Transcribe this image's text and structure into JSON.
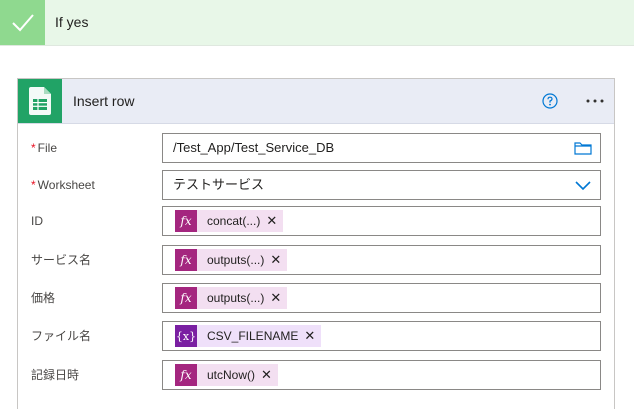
{
  "branch": {
    "title": "If yes"
  },
  "action": {
    "title": "Insert row",
    "fields": [
      {
        "label": "File",
        "required": true,
        "value": "/Test_App/Test_Service_DB",
        "type": "text"
      },
      {
        "label": "Worksheet",
        "required": true,
        "value": "テストサービス",
        "type": "dropdown"
      },
      {
        "label": "ID",
        "required": false,
        "type": "token",
        "token": {
          "kind": "expression",
          "icon": "fx",
          "text": "concat(...)"
        }
      },
      {
        "label": "サービス名",
        "required": false,
        "type": "token",
        "token": {
          "kind": "expression",
          "icon": "fx",
          "text": "outputs(...)"
        }
      },
      {
        "label": "価格",
        "required": false,
        "type": "token",
        "token": {
          "kind": "expression",
          "icon": "fx",
          "text": "outputs(...)"
        }
      },
      {
        "label": "ファイル名",
        "required": false,
        "type": "token",
        "token": {
          "kind": "variable",
          "icon": "{x}",
          "text": "CSV_FILENAME"
        }
      },
      {
        "label": "記録日時",
        "required": false,
        "type": "token",
        "token": {
          "kind": "expression",
          "icon": "fx",
          "text": "utcNow()"
        }
      }
    ]
  },
  "colors": {
    "branch_bg": "#e8f7e8",
    "check_bg": "#8fd98f",
    "card_header_bg": "#e9ecf5",
    "sheets_green": "#21a366",
    "expression_token": "#a4267f",
    "variable_token": "#7a1fa2",
    "accent": "#0078d4",
    "required": "#e81123"
  },
  "icons": {
    "check": "checkmark-icon",
    "app": "google-sheets-icon",
    "help": "help-circle-icon",
    "more": "more-options-icon",
    "folder": "folder-icon",
    "dropdown": "chevron-down-icon",
    "remove": "close-icon"
  }
}
